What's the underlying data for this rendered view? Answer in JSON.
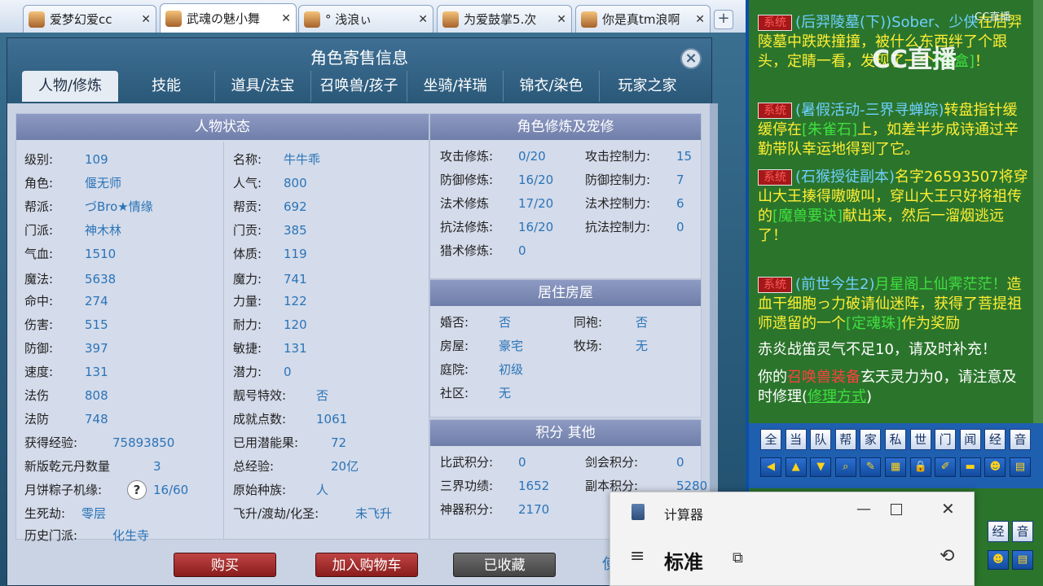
{
  "browser_tabs": [
    {
      "title": "爱梦幻爱cc",
      "active": false
    },
    {
      "title": "武魂の魅小舞",
      "active": true
    },
    {
      "title": "° 浅浪ぃ",
      "active": false
    },
    {
      "title": "为爱鼓掌5.次",
      "active": false
    },
    {
      "title": "你是真tm浪啊",
      "active": false
    }
  ],
  "browser_new_tab": "+",
  "dialog": {
    "title": "角色寄售信息",
    "close": "×",
    "tabs": [
      "人物/修炼",
      "技能",
      "道具/法宝",
      "召唤兽/孩子",
      "坐骑/祥瑞",
      "锦衣/染色",
      "玩家之家"
    ]
  },
  "status": {
    "header": "人物状态",
    "left": [
      {
        "label": "级别:",
        "value": "109"
      },
      {
        "label": "角色:",
        "value": "偃无师"
      },
      {
        "label": "帮派:",
        "value": "づBro★情缘"
      },
      {
        "label": "门派:",
        "value": "神木林"
      },
      {
        "label": "气血:",
        "value": "1510"
      },
      {
        "label": "魔法:",
        "value": "5638"
      },
      {
        "label": "命中:",
        "value": "274"
      },
      {
        "label": "伤害:",
        "value": "515"
      },
      {
        "label": "防御:",
        "value": "397"
      },
      {
        "label": "速度:",
        "value": "131"
      },
      {
        "label": "法伤",
        "value": "808"
      },
      {
        "label": "法防",
        "value": "748"
      },
      {
        "label": "获得经验:",
        "value": "75893850"
      },
      {
        "label": "新版乾元丹数量",
        "value": "3"
      },
      {
        "label": "月饼粽子机缘:",
        "value": "16/60"
      },
      {
        "label": "生死劫:",
        "value": "零层"
      },
      {
        "label": "历史门派:",
        "value": "化生寺"
      }
    ],
    "help_mark": "?",
    "right": [
      {
        "label": "名称:",
        "value": "牛牛乖"
      },
      {
        "label": "人气:",
        "value": "800"
      },
      {
        "label": "帮贡:",
        "value": "692"
      },
      {
        "label": "门贡:",
        "value": "385"
      },
      {
        "label": "体质:",
        "value": "119"
      },
      {
        "label": "魔力:",
        "value": "741"
      },
      {
        "label": "力量:",
        "value": "122"
      },
      {
        "label": "耐力:",
        "value": "120"
      },
      {
        "label": "敏捷:",
        "value": "131"
      },
      {
        "label": "潜力:",
        "value": "0"
      },
      {
        "label": "靓号特效:",
        "value": "否"
      },
      {
        "label": "成就点数:",
        "value": "1061"
      },
      {
        "label": "已用潜能果:",
        "value": "72"
      },
      {
        "label": "总经验:",
        "value": "20亿"
      },
      {
        "label": "原始种族:",
        "value": "人"
      },
      {
        "label": "飞升/渡劫/化圣:",
        "value": "未飞升"
      }
    ]
  },
  "cultivation": {
    "header": "角色修炼及宠修",
    "rows": [
      {
        "l1": "攻击修炼:",
        "v1": "0/20",
        "l2": "攻击控制力:",
        "v2": "15"
      },
      {
        "l1": "防御修炼:",
        "v1": "16/20",
        "l2": "防御控制力:",
        "v2": "7"
      },
      {
        "l1": "法术修炼",
        "v1": "17/20",
        "l2": "法术控制力:",
        "v2": "6"
      },
      {
        "l1": "抗法修炼:",
        "v1": "16/20",
        "l2": "抗法控制力:",
        "v2": "0"
      },
      {
        "l1": "猎术修炼:",
        "v1": "0",
        "l2": "",
        "v2": ""
      }
    ]
  },
  "housing": {
    "header": "居住房屋",
    "rows": [
      {
        "l1": "婚否:",
        "v1": "否",
        "l2": "同袍:",
        "v2": "否"
      },
      {
        "l1": "房屋:",
        "v1": "豪宅",
        "l2": "牧场:",
        "v2": "无"
      },
      {
        "l1": "庭院:",
        "v1": "初级",
        "l2": "",
        "v2": ""
      },
      {
        "l1": "社区:",
        "v1": "无",
        "l2": "",
        "v2": ""
      }
    ]
  },
  "points": {
    "header": "积分 其他",
    "rows": [
      {
        "l1": "比武积分:",
        "v1": "0",
        "l2": "剑会积分:",
        "v2": "0"
      },
      {
        "l1": "三界功绩:",
        "v1": "1652",
        "l2": "副本积分:",
        "v2": "5280"
      },
      {
        "l1": "神器积分:",
        "v1": "2170",
        "l2": "",
        "v2": ""
      }
    ]
  },
  "buttons": {
    "buy": "购买",
    "add_cart": "加入购物车",
    "favorited": "已收藏",
    "partial": "使"
  },
  "chat": {
    "system_tag": "系统",
    "watermark": "CC直播",
    "watermark_small": "CC直播",
    "messages": [
      {
        "channel": "(后羿陵墓(下))Sober、少侠",
        "text": "在后羿陵墓中跌跌撞撞，被什么东西绊了个跟头，定睛一看，发现了一个",
        "item": "[锦盒]",
        "end": "！"
      },
      {
        "channel": "(暑假活动-三界寻蝉踪)",
        "text": "转盘指针缓缓停在",
        "item": "[朱雀石]",
        "text2": "上，如差半步成诗通过辛勤带队幸运地得到了它。"
      },
      {
        "channel": "(石猴授徒副本)",
        "text": "名字26593507将穿山大王揍得嗷嗷叫，穿山大王只好将祖传的",
        "item": "[魔兽要诀]",
        "text2": "献出来，然后一溜烟逃远了！"
      },
      {
        "channel": "(前世今生2)",
        "text_green": "月星阁上仙霁茫茫！",
        "text": "造血干细胞っ力破请仙迷阵，获得了菩提祖师遗留的一个",
        "item": "[定魂珠]",
        "text2": "作为奖励"
      }
    ],
    "notice1": "赤炎战笛灵气不足10，请及时补充！",
    "notice2_a": "你的",
    "notice2_red": "召唤兽装备",
    "notice2_b": "玄天灵力为0，请注意及时修理(",
    "notice2_link": "修理方式",
    "notice2_end": ")",
    "channels": [
      "全",
      "当",
      "队",
      "帮",
      "家",
      "私",
      "世",
      "门",
      "闻",
      "经",
      "音"
    ],
    "channels_lower": [
      "经",
      "音"
    ]
  },
  "calculator": {
    "title": "计算器",
    "mode": "标准"
  }
}
